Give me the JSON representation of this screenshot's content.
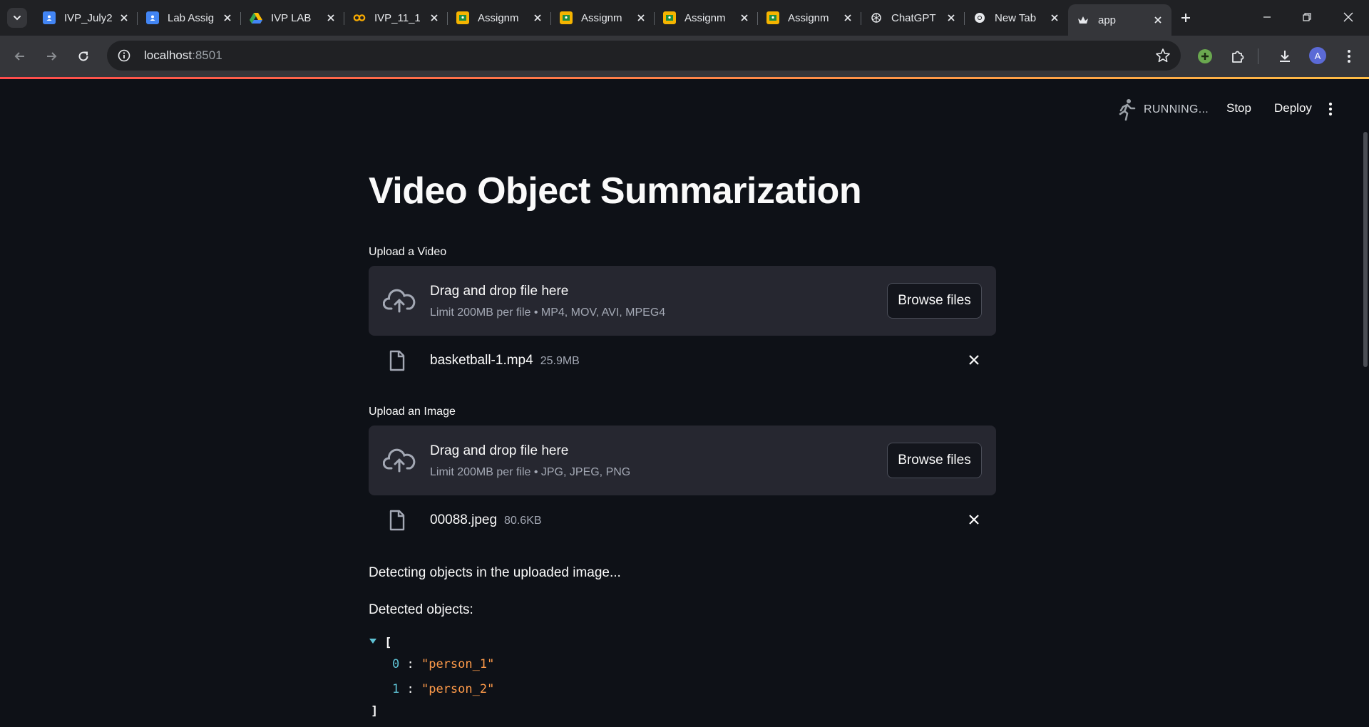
{
  "browser": {
    "tabs": [
      {
        "title": "IVP_July2",
        "icon": "google-sheets-person-icon",
        "color": "#4285f4"
      },
      {
        "title": "Lab Assig",
        "icon": "google-sheets-person-icon",
        "color": "#4285f4"
      },
      {
        "title": "IVP LAB",
        "icon": "google-drive-icon",
        "color": "#fbbc04"
      },
      {
        "title": "IVP_11_1",
        "icon": "colab-icon",
        "color": "#f9ab00"
      },
      {
        "title": "Assignm",
        "icon": "google-classroom-icon",
        "color": "#f5b400"
      },
      {
        "title": "Assignm",
        "icon": "google-classroom-icon",
        "color": "#f5b400"
      },
      {
        "title": "Assignm",
        "icon": "google-classroom-icon",
        "color": "#f5b400"
      },
      {
        "title": "Assignm",
        "icon": "google-classroom-icon",
        "color": "#f5b400"
      },
      {
        "title": "ChatGPT",
        "icon": "chatgpt-icon",
        "color": "#e8eaed"
      },
      {
        "title": "New Tab",
        "icon": "chrome-icon",
        "color": "#e8eaed"
      },
      {
        "title": "app",
        "icon": "streamlit-icon",
        "color": "#e8eaed",
        "active": true
      }
    ],
    "url_host": "localhost",
    "url_port": ":8501",
    "profile_initial": "A"
  },
  "app_header": {
    "status": "RUNNING...",
    "stop_label": "Stop",
    "deploy_label": "Deploy"
  },
  "main": {
    "title": "Video Object Summarization",
    "video_uploader": {
      "label": "Upload a Video",
      "drop_text": "Drag and drop file here",
      "limit_text": "Limit 200MB per file • MP4, MOV, AVI, MPEG4",
      "browse_label": "Browse files",
      "file_name": "basketball-1.mp4",
      "file_size": "25.9MB"
    },
    "image_uploader": {
      "label": "Upload an Image",
      "drop_text": "Drag and drop file here",
      "limit_text": "Limit 200MB per file • JPG, JPEG, PNG",
      "browse_label": "Browse files",
      "file_name": "00088.jpeg",
      "file_size": "80.6KB"
    },
    "detecting_text": "Detecting objects in the uploaded image...",
    "detected_label": "Detected objects:",
    "json_open": "[",
    "json_close": "]",
    "detected_objects": [
      {
        "index": "0",
        "value": "\"person_1\""
      },
      {
        "index": "1",
        "value": "\"person_2\""
      }
    ]
  }
}
